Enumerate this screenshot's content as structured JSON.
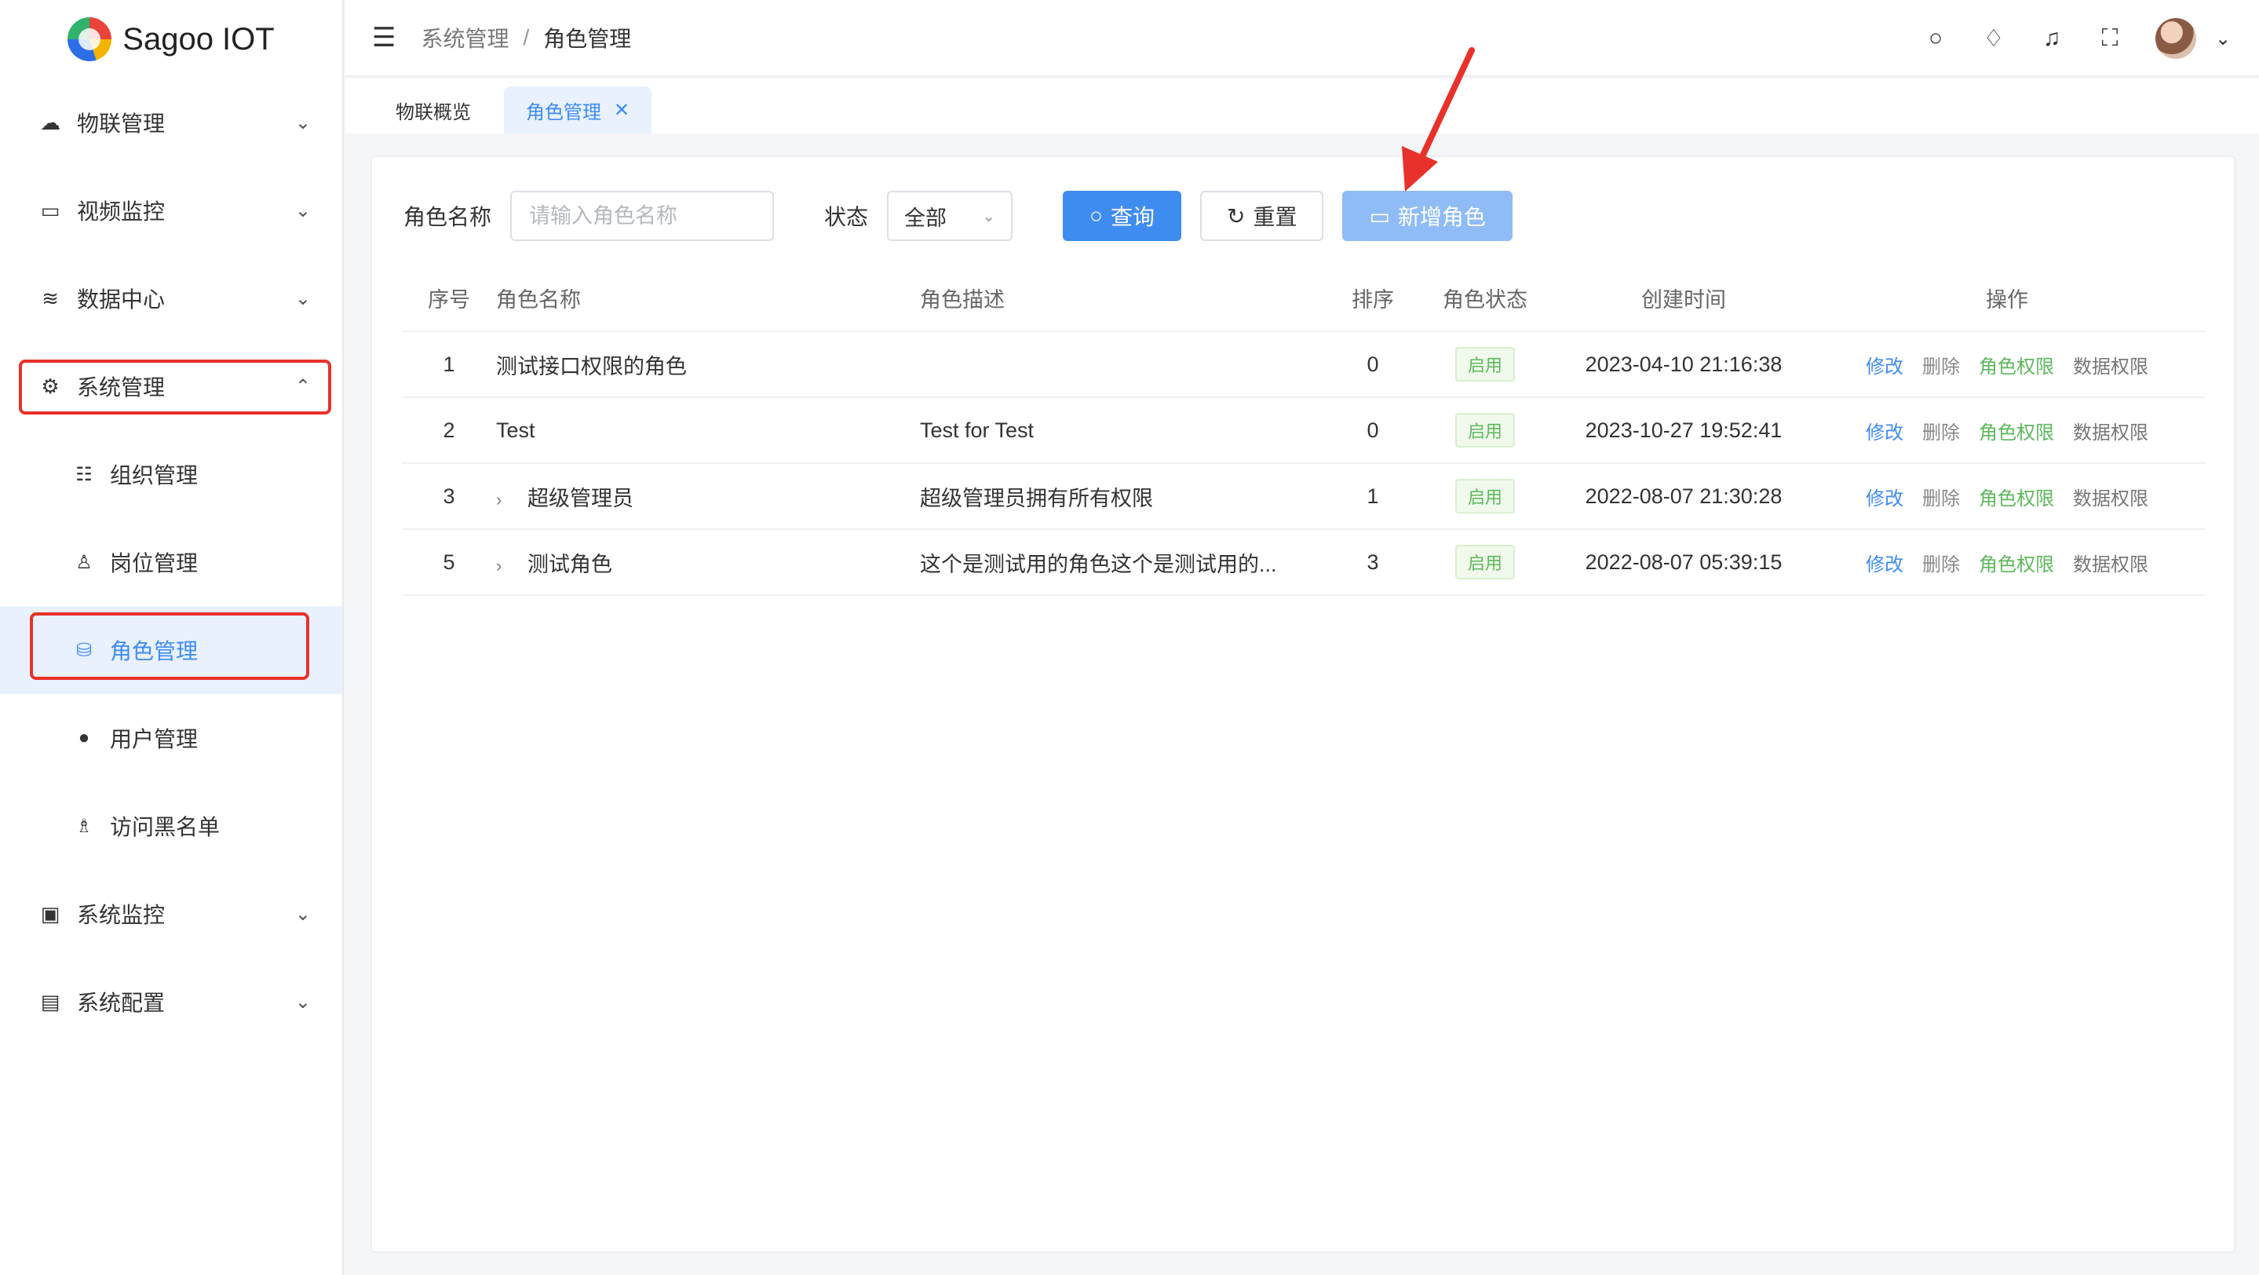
{
  "app": {
    "name": "Sagoo IOT"
  },
  "sidebar": {
    "items": [
      {
        "label": "物联管理",
        "icon": "cloud-icon"
      },
      {
        "label": "视频监控",
        "icon": "video-icon"
      },
      {
        "label": "数据中心",
        "icon": "database-icon"
      },
      {
        "label": "系统管理",
        "icon": "gear-icon"
      },
      {
        "label": "系统监控",
        "icon": "monitor-icon"
      },
      {
        "label": "系统配置",
        "icon": "config-icon"
      }
    ],
    "sub_items": [
      {
        "label": "组织管理",
        "icon": "org-icon"
      },
      {
        "label": "岗位管理",
        "icon": "post-icon"
      },
      {
        "label": "角色管理",
        "icon": "role-icon"
      },
      {
        "label": "用户管理",
        "icon": "user-icon"
      },
      {
        "label": "访问黑名单",
        "icon": "blacklist-icon"
      }
    ]
  },
  "header": {
    "breadcrumb": [
      "系统管理",
      "角色管理"
    ]
  },
  "tabs": [
    {
      "label": "物联概览"
    },
    {
      "label": "角色管理",
      "close": "✕"
    }
  ],
  "search": {
    "name_label": "角色名称",
    "name_placeholder": "请输入角色名称",
    "status_label": "状态",
    "status_value": "全部",
    "query_btn": "查询",
    "reset_btn": "重置",
    "add_btn": "新增角色"
  },
  "table": {
    "columns": [
      "序号",
      "角色名称",
      "角色描述",
      "排序",
      "角色状态",
      "创建时间",
      "操作"
    ],
    "actions": [
      "修改",
      "删除",
      "角色权限",
      "数据权限"
    ],
    "rows": [
      {
        "id": "1",
        "name": "测试接口权限的角色",
        "desc": "",
        "sort": "0",
        "status": "启用",
        "created": "2023-04-10 21:16:38",
        "expandable": false
      },
      {
        "id": "2",
        "name": "Test",
        "desc": "Test for Test",
        "sort": "0",
        "status": "启用",
        "created": "2023-10-27 19:52:41",
        "expandable": false
      },
      {
        "id": "3",
        "name": "超级管理员",
        "desc": "超级管理员拥有所有权限",
        "sort": "1",
        "status": "启用",
        "created": "2022-08-07 21:30:28",
        "expandable": true
      },
      {
        "id": "5",
        "name": "测试角色",
        "desc": "这个是测试用的角色这个是测试用的...",
        "sort": "3",
        "status": "启用",
        "created": "2022-08-07 05:39:15",
        "expandable": true
      }
    ]
  },
  "colors": {
    "primary": "#3f8cf0",
    "success": "#5cb85c",
    "highlight": "#e8312a"
  }
}
